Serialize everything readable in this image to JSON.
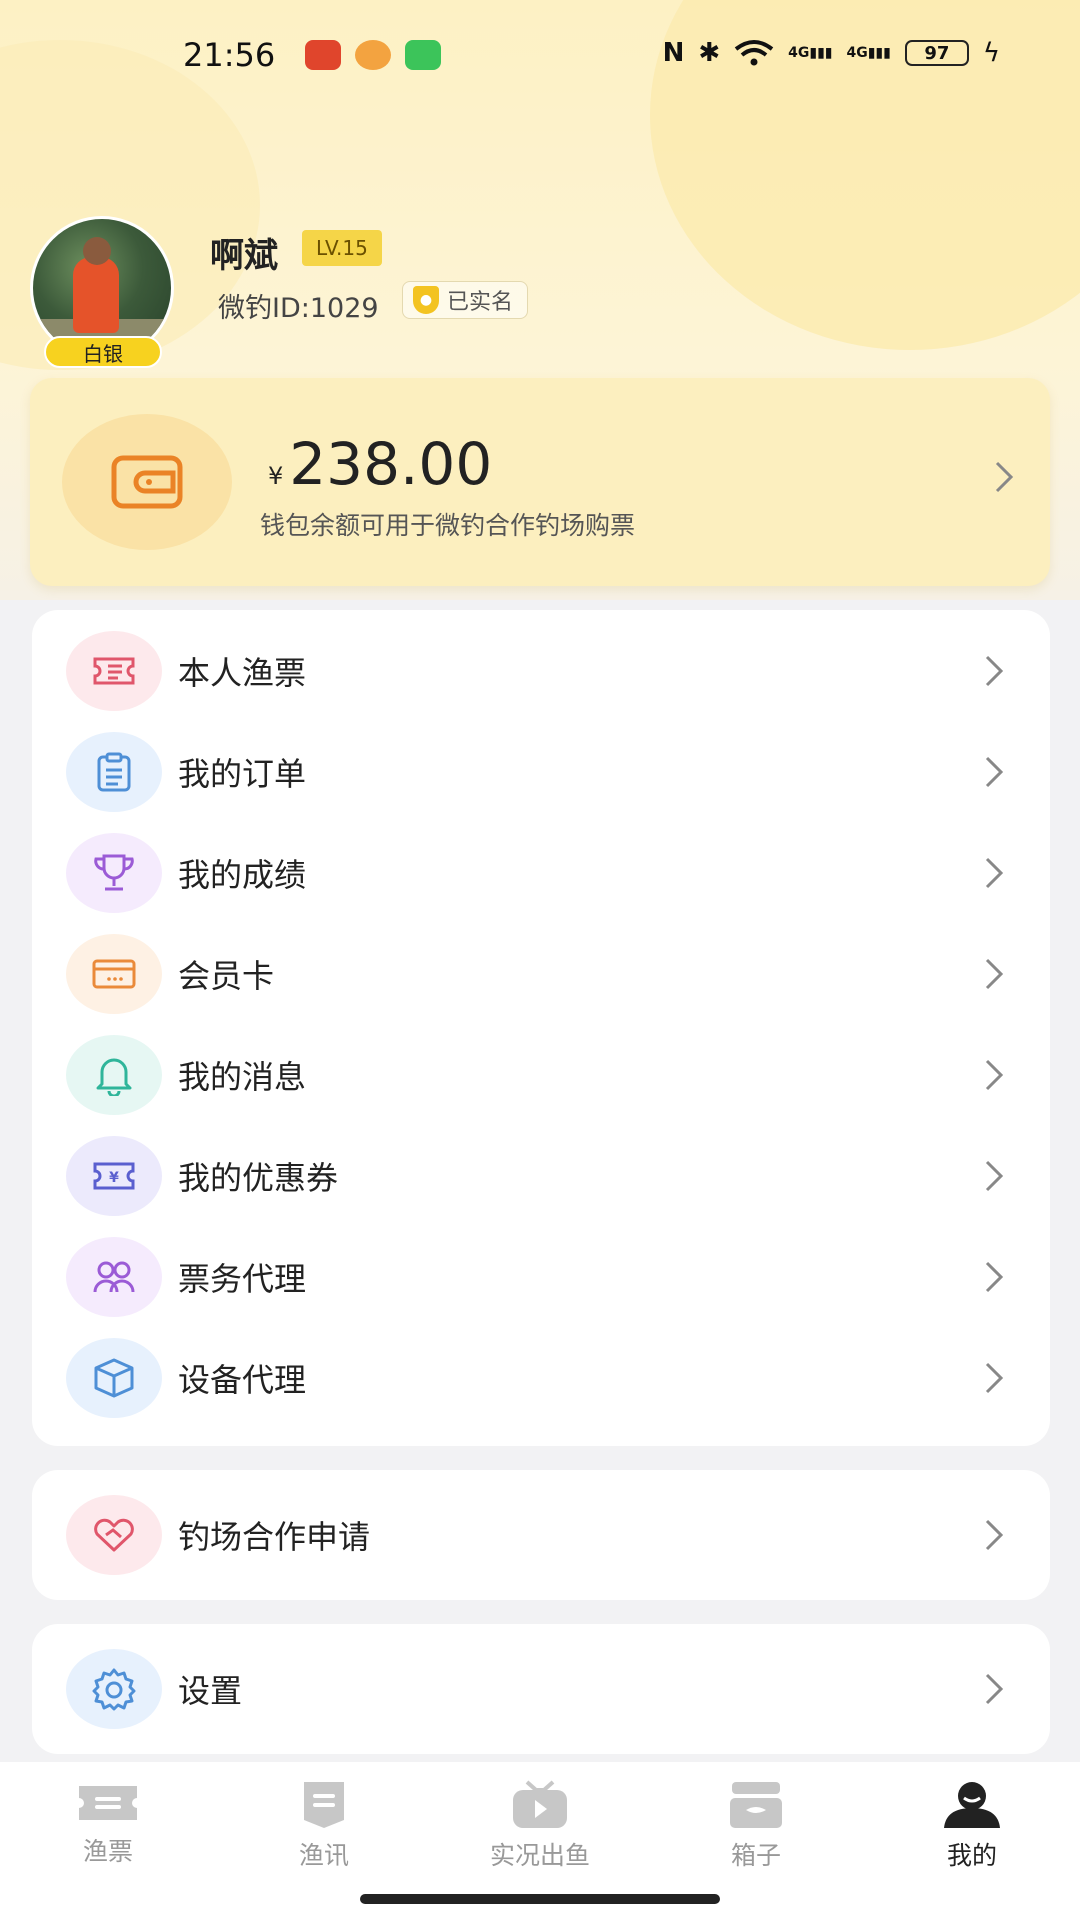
{
  "status_bar": {
    "time": "21:56",
    "battery": "97",
    "network_labels": [
      "4G",
      "4G"
    ]
  },
  "profile": {
    "name": "啊斌",
    "level": "LV.15",
    "rank": "白银",
    "user_id": "微钓ID:1029",
    "verified": "已实名"
  },
  "wallet": {
    "currency": "¥",
    "balance": "238.00",
    "description": "钱包余额可用于微钓合作钓场购票"
  },
  "menu_main": [
    {
      "label": "本人渔票",
      "icon": "ticket-icon",
      "bg": "#fde9ec",
      "color": "#e0566b"
    },
    {
      "label": "我的订单",
      "icon": "clipboard-icon",
      "bg": "#e7f1fd",
      "color": "#4e8fd6"
    },
    {
      "label": "我的成绩",
      "icon": "trophy-icon",
      "bg": "#f5ebfd",
      "color": "#9b5bd6"
    },
    {
      "label": "会员卡",
      "icon": "card-icon",
      "bg": "#fef1e4",
      "color": "#ea8a3a"
    },
    {
      "label": "我的消息",
      "icon": "bell-icon",
      "bg": "#e6f7f3",
      "color": "#2fb59a"
    },
    {
      "label": "我的优惠券",
      "icon": "coupon-icon",
      "bg": "#eceafc",
      "color": "#5a5fcf"
    },
    {
      "label": "票务代理",
      "icon": "group-icon",
      "bg": "#f5ebfd",
      "color": "#9b5bd6"
    },
    {
      "label": "设备代理",
      "icon": "box-icon",
      "bg": "#e7f1fd",
      "color": "#4e8fd6"
    }
  ],
  "menu_partner": {
    "label": "钓场合作申请",
    "icon": "handshake-icon",
    "bg": "#fde9ec",
    "color": "#e0566b"
  },
  "menu_settings": {
    "label": "设置",
    "icon": "gear-icon",
    "bg": "#e7f1fd",
    "color": "#4e8fd6"
  },
  "bottom_nav": [
    {
      "label": "渔票",
      "icon": "ticket-nav-icon",
      "active": false
    },
    {
      "label": "渔讯",
      "icon": "news-nav-icon",
      "active": false
    },
    {
      "label": "实况出鱼",
      "icon": "video-nav-icon",
      "active": false
    },
    {
      "label": "箱子",
      "icon": "box-nav-icon",
      "active": false
    },
    {
      "label": "我的",
      "icon": "profile-nav-icon",
      "active": true
    }
  ]
}
